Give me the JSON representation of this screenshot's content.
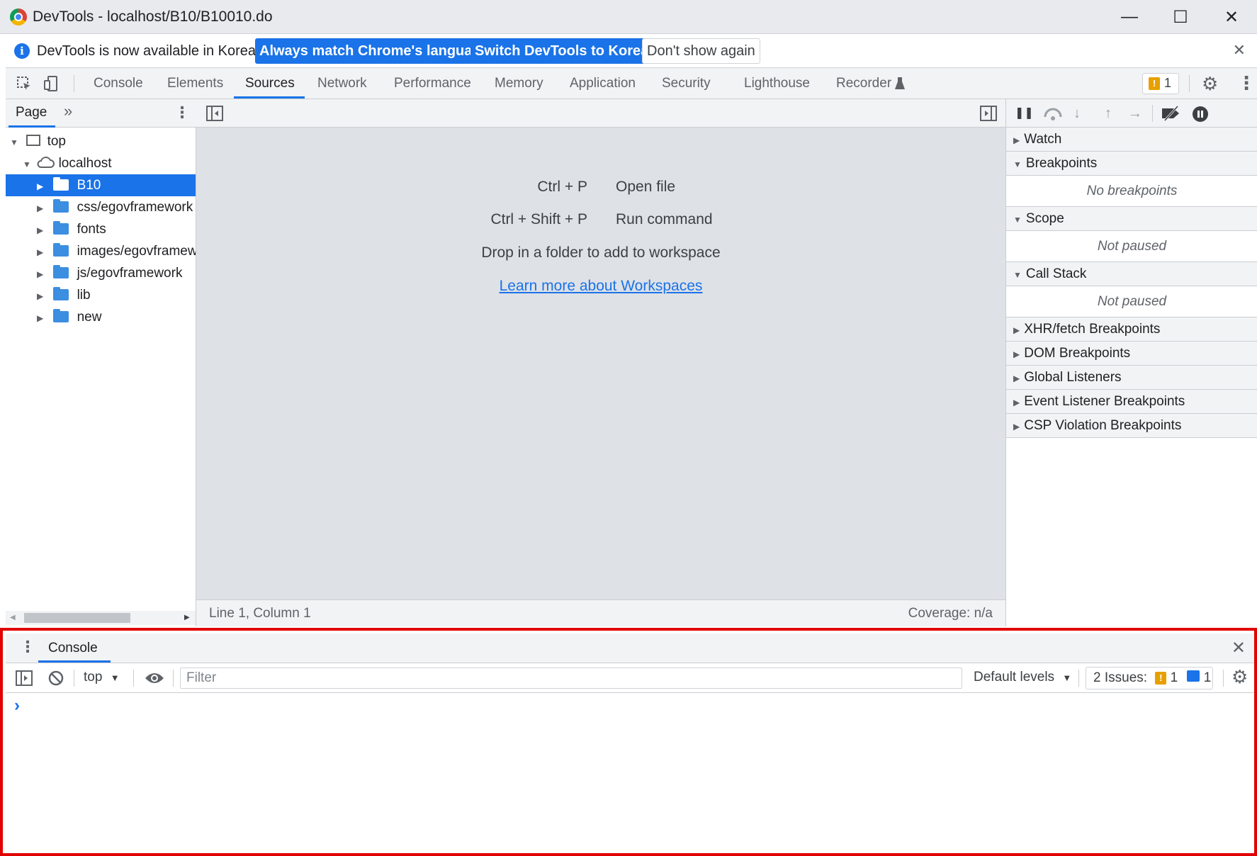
{
  "window": {
    "title": "DevTools - localhost/B10/B10010.do",
    "minimize": "—",
    "maximize": "☐",
    "close": "✕"
  },
  "infobar": {
    "message": "DevTools is now available in Korean!",
    "btn_match": "Always match Chrome's language",
    "btn_switch": "Switch DevTools to Korean",
    "btn_dismiss": "Don't show again",
    "close": "✕"
  },
  "tabs": {
    "items": [
      "Console",
      "Elements",
      "Sources",
      "Network",
      "Performance",
      "Memory",
      "Application",
      "Security",
      "Lighthouse",
      "Recorder"
    ],
    "active": "Sources",
    "issues_count": "1"
  },
  "navigator": {
    "tab": "Page",
    "more": "»",
    "tree": [
      {
        "label": "top"
      },
      {
        "label": "localhost"
      },
      {
        "label": "B10"
      },
      {
        "label": "css/egovframework"
      },
      {
        "label": "fonts"
      },
      {
        "label": "images/egovframewo"
      },
      {
        "label": "js/egovframework"
      },
      {
        "label": "lib"
      },
      {
        "label": "new"
      }
    ]
  },
  "editor": {
    "shortcut1_keys": "Ctrl + P",
    "shortcut1_action": "Open file",
    "shortcut2_keys": "Ctrl + Shift + P",
    "shortcut2_action": "Run command",
    "drop_hint": "Drop in a folder to add to workspace",
    "learn_link": "Learn more about Workspaces",
    "status_position": "Line 1, Column 1",
    "status_coverage": "Coverage: n/a"
  },
  "debugger": {
    "watch": "Watch",
    "breakpoints": "Breakpoints",
    "no_breakpoints": "No breakpoints",
    "scope": "Scope",
    "scope_status": "Not paused",
    "callstack": "Call Stack",
    "callstack_status": "Not paused",
    "xhr": "XHR/fetch Breakpoints",
    "dom": "DOM Breakpoints",
    "global": "Global Listeners",
    "event": "Event Listener Breakpoints",
    "csp": "CSP Violation Breakpoints"
  },
  "drawer": {
    "tab": "Console",
    "context": "top",
    "filter_placeholder": "Filter",
    "levels": "Default levels",
    "issues_label": "2 Issues:",
    "issues_warn": "1",
    "issues_info": "1",
    "prompt": "›"
  },
  "colors": {
    "accent": "#1a73e8",
    "highlight_border": "#e00000",
    "warning": "#e8a000"
  }
}
